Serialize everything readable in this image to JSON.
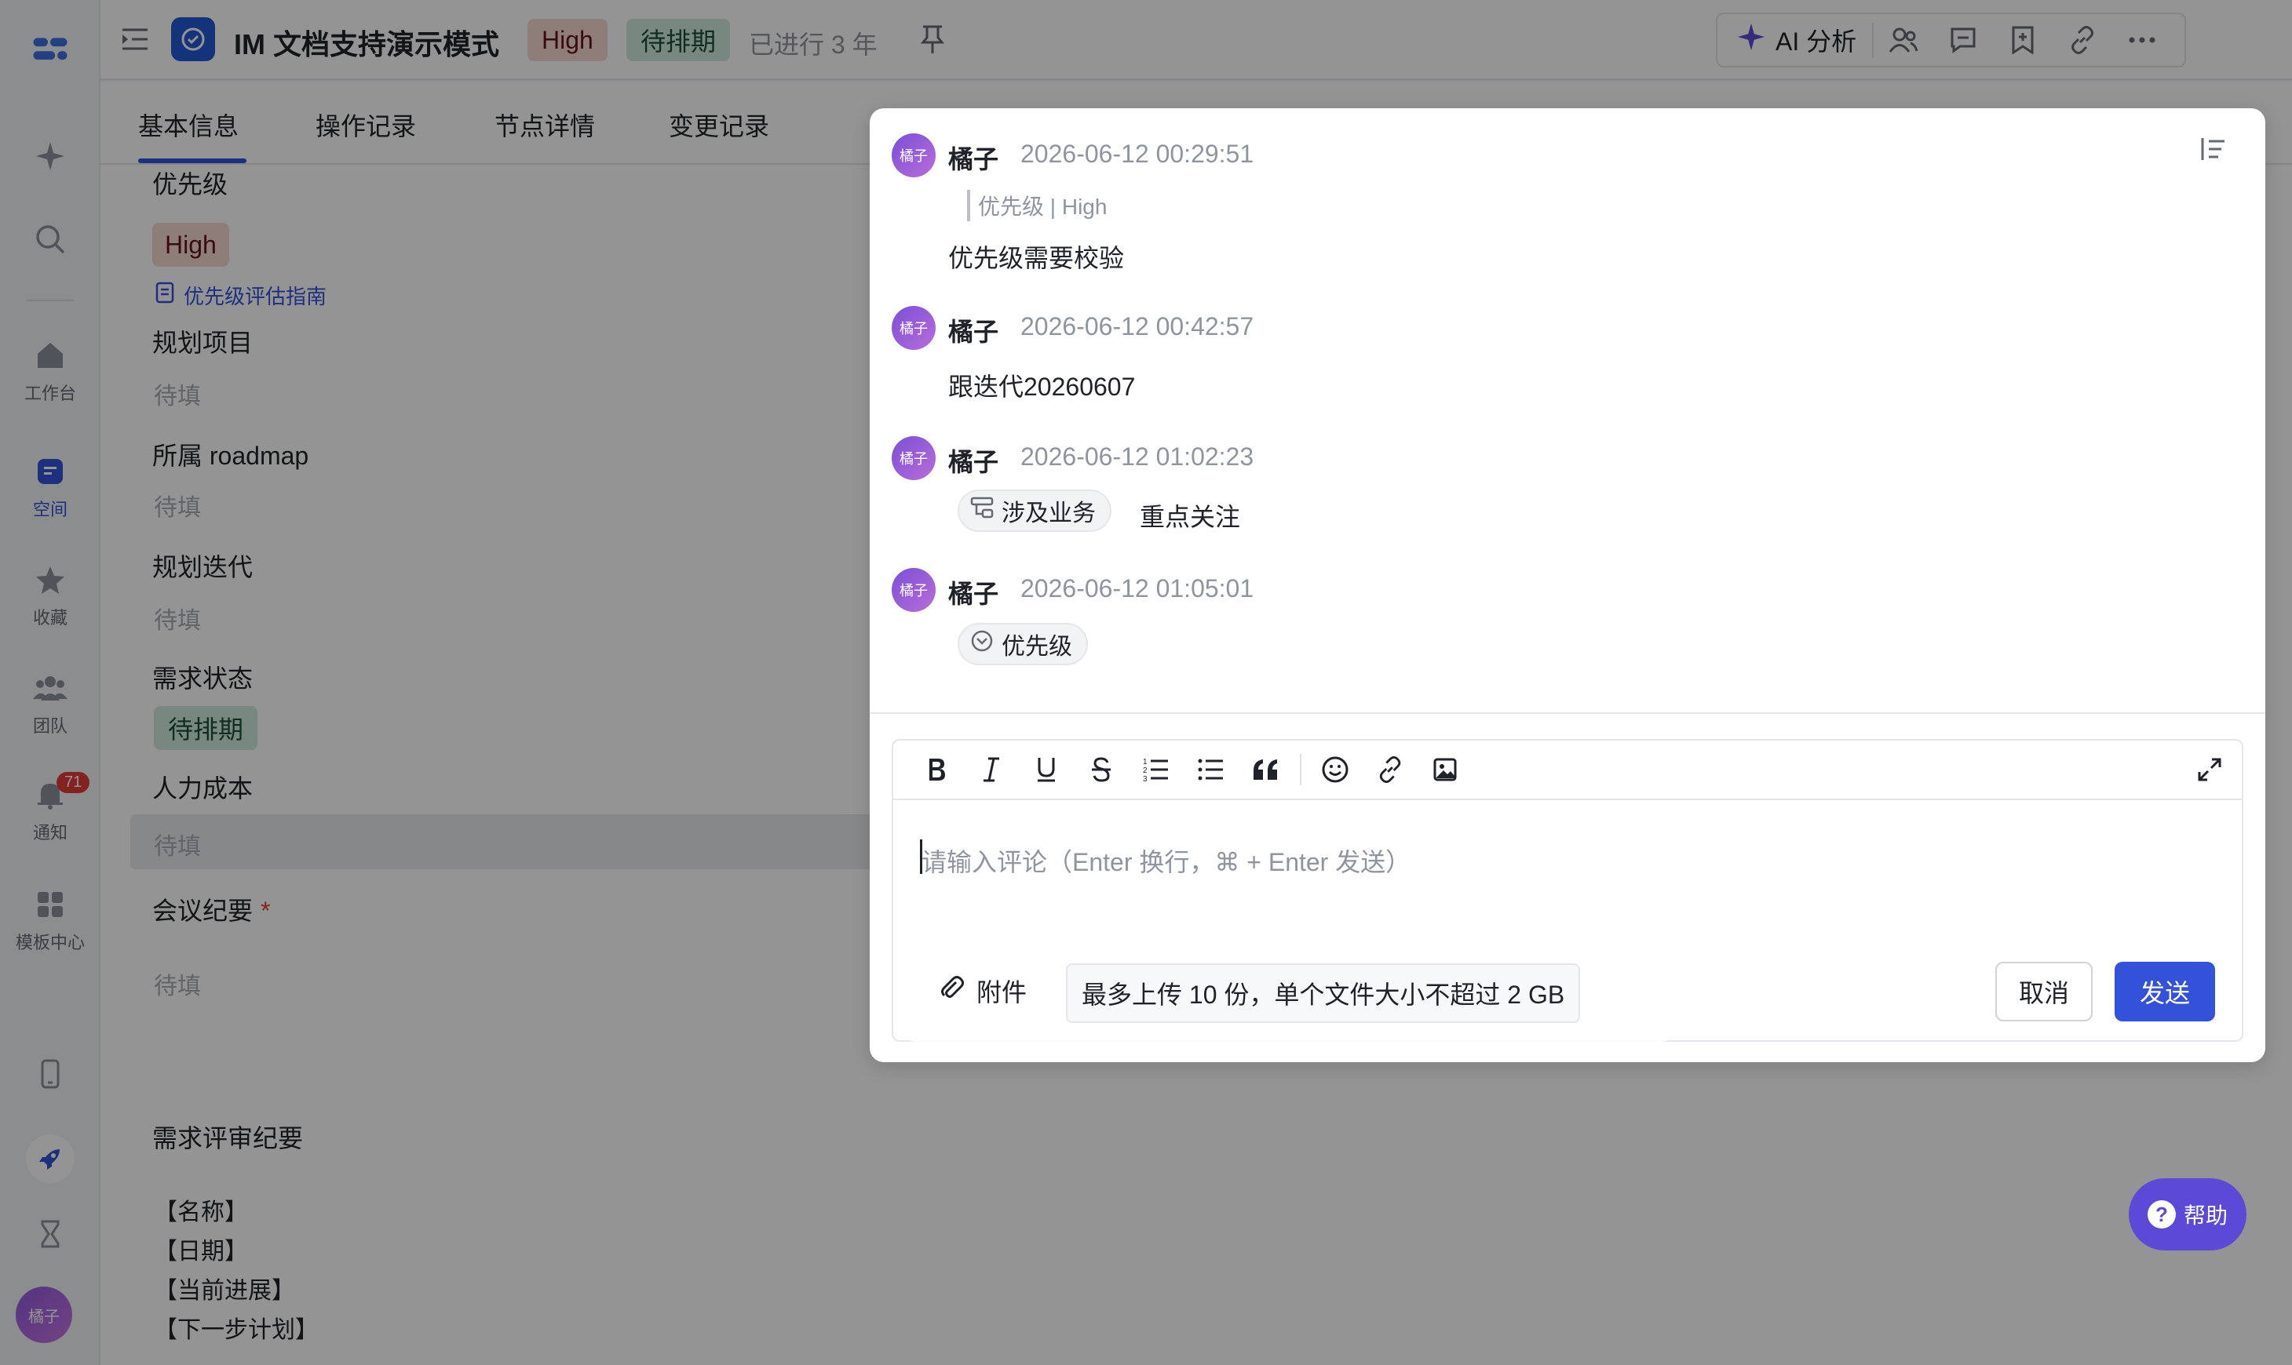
{
  "rail": {
    "items": [
      {
        "label": ""
      },
      {
        "label": ""
      },
      {
        "label": "工作台"
      },
      {
        "label": "空间"
      },
      {
        "label": "收藏"
      },
      {
        "label": "团队"
      },
      {
        "label": "通知"
      },
      {
        "label": "模板中心"
      }
    ],
    "notification_badge": "71",
    "avatar": "橘子"
  },
  "header": {
    "title": "IM 文档支持演示模式",
    "priority_tag": "High",
    "status_tag": "待排期",
    "elapsed": "已进行 3 年",
    "ai_button": "AI 分析"
  },
  "tabs": [
    {
      "label": "基本信息"
    },
    {
      "label": "操作记录"
    },
    {
      "label": "节点详情"
    },
    {
      "label": "变更记录"
    }
  ],
  "fields": {
    "priority": {
      "label": "优先级",
      "value": "High",
      "guide": "优先级评估指南"
    },
    "plan_project": {
      "label": "规划项目",
      "placeholder": "待填"
    },
    "roadmap": {
      "label": "所属 roadmap",
      "placeholder": "待填"
    },
    "plan_iteration": {
      "label": "规划迭代",
      "placeholder": "待填"
    },
    "req_status": {
      "label": "需求状态",
      "value": "待排期"
    },
    "labor_cost": {
      "label": "人力成本",
      "placeholder": "待填"
    },
    "meeting_notes": {
      "label": "会议纪要",
      "required": "*",
      "placeholder": "待填"
    }
  },
  "review": {
    "title": "需求评审纪要",
    "lines": [
      "【名称】",
      "【日期】",
      "【当前进展】",
      "【下一步计划】"
    ]
  },
  "comments": [
    {
      "avatar": "橘子",
      "name": "橘子",
      "time": "2026-06-12 00:29:51",
      "quote_field": "优先级",
      "quote_value": "High",
      "text": "优先级需要校验"
    },
    {
      "avatar": "橘子",
      "name": "橘子",
      "time": "2026-06-12 00:42:57",
      "text": "跟迭代20260607"
    },
    {
      "avatar": "橘子",
      "name": "橘子",
      "time": "2026-06-12 01:02:23",
      "chip": "涉及业务",
      "text": "重点关注"
    },
    {
      "avatar": "橘子",
      "name": "橘子",
      "time": "2026-06-12 01:05:01",
      "chip": "优先级"
    }
  ],
  "editor": {
    "placeholder": "请输入评论（Enter 换行，⌘ + Enter 发送）",
    "attach_label": "附件",
    "attach_tip": "最多上传 10 份，单个文件大小不超过 2 GB",
    "cancel": "取消",
    "send": "发送"
  },
  "help": {
    "label": "帮助",
    "q": "?"
  },
  "colors": {
    "accent": "#3452d9",
    "high_bg": "#f6d7d3",
    "pending_bg": "#cfe9dc",
    "help": "#5b4ad8"
  }
}
